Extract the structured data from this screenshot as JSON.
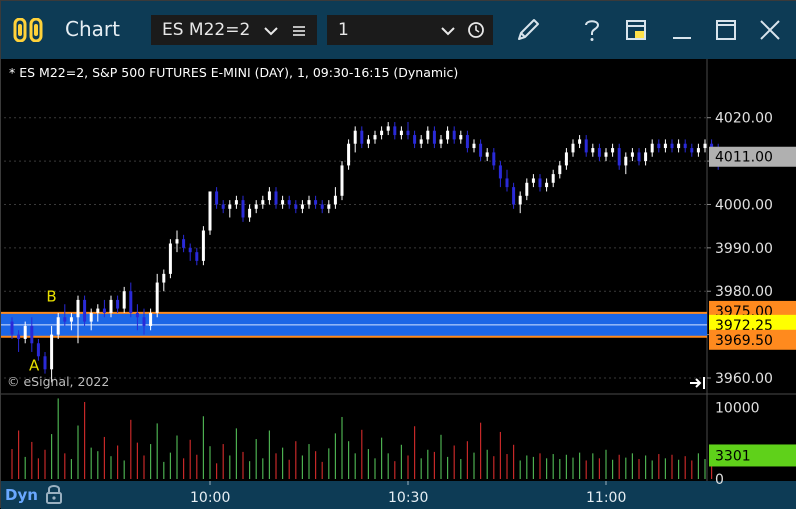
{
  "titlebar": {
    "title": "Chart",
    "symbol": "ES M22=2",
    "interval": "1",
    "icons": [
      "chart-logo-icon",
      "chevron-down-icon",
      "menu-lines-icon",
      "chevron-down-icon",
      "clock-icon",
      "pencil-icon",
      "help-icon",
      "pages-icon",
      "minimize-icon",
      "maximize-icon",
      "close-icon"
    ]
  },
  "chart": {
    "info_line": "* ES M22=2, S&P 500 FUTURES E-MINI (DAY), 1, 09:30-16:15 (Dynamic)",
    "watermark": "© eSignal, 2022",
    "dyn_label": "Dyn",
    "marker_a": "A",
    "marker_b": "B",
    "icons": [
      "jump-to-end-icon",
      "lock-icon"
    ]
  },
  "colors": {
    "titlebar": "#0d3b55",
    "up_candle": "#ffffff",
    "down_candle": "#2a2ad8",
    "zone_fill": "#1d6cf2",
    "zone_edge": "#ff8a1e",
    "volume_up": "#4caf50",
    "volume_down": "#c62828",
    "last_price": "#b0b0b0",
    "last_volume": "#5fd11a"
  },
  "chart_data": {
    "type": "candlestick",
    "price_axis": {
      "ticks": [
        "4020.00",
        "4010.00",
        "4000.00",
        "3990.00",
        "3980.00",
        "3970.00",
        "3960.00"
      ],
      "range": [
        3957,
        4028
      ]
    },
    "price_labels": [
      {
        "text": "4011.00",
        "value": 4011.0,
        "kind": "last-price"
      },
      {
        "text": "3975.00",
        "value": 3975.0,
        "kind": "zone-top"
      },
      {
        "text": "3972.25",
        "value": 3972.25,
        "kind": "zone-mid"
      },
      {
        "text": "3969.50",
        "value": 3969.5,
        "kind": "zone-bottom"
      }
    ],
    "zone": {
      "top": 3975.0,
      "mid": 3972.25,
      "bottom": 3969.5
    },
    "volume_axis": {
      "ticks": [
        "10000",
        "0"
      ],
      "range": [
        0,
        11500
      ]
    },
    "volume_label": {
      "text": "3301",
      "value": 3301
    },
    "time_axis": {
      "ticks": [
        "10:00",
        "10:30",
        "11:00"
      ],
      "tick_bar_index": [
        30,
        60,
        90
      ]
    },
    "ohlc": [
      [
        3973.0,
        3974.0,
        3969.0,
        3970.0
      ],
      [
        3970.0,
        3971.0,
        3966.0,
        3969.0
      ],
      [
        3969.0,
        3973.0,
        3968.0,
        3972.0
      ],
      [
        3972.0,
        3974.0,
        3966.0,
        3968.0
      ],
      [
        3968.0,
        3969.0,
        3964.0,
        3965.0
      ],
      [
        3965.0,
        3966.0,
        3961.0,
        3962.0
      ],
      [
        3962.0,
        3972.0,
        3959.0,
        3970.0
      ],
      [
        3970.0,
        3975.0,
        3969.0,
        3974.0
      ],
      [
        3974.0,
        3977.0,
        3972.0,
        3973.0
      ],
      [
        3973.0,
        3975.0,
        3971.0,
        3974.0
      ],
      [
        3974.0,
        3979.0,
        3968.0,
        3978.0
      ],
      [
        3978.0,
        3979.0,
        3972.0,
        3973.0
      ],
      [
        3973.0,
        3976.0,
        3971.0,
        3975.0
      ],
      [
        3975.0,
        3977.0,
        3973.0,
        3976.0
      ],
      [
        3976.0,
        3978.0,
        3974.0,
        3975.0
      ],
      [
        3975.0,
        3979.0,
        3974.0,
        3978.0
      ],
      [
        3978.0,
        3979.0,
        3975.0,
        3976.0
      ],
      [
        3976.0,
        3981.0,
        3975.0,
        3980.0
      ],
      [
        3980.0,
        3982.0,
        3974.0,
        3975.0
      ],
      [
        3975.0,
        3977.0,
        3971.0,
        3974.0
      ],
      [
        3974.0,
        3976.0,
        3970.0,
        3972.0
      ],
      [
        3972.0,
        3976.0,
        3971.0,
        3975.0
      ],
      [
        3975.0,
        3984.0,
        3974.0,
        3982.0
      ],
      [
        3982.0,
        3985.0,
        3980.0,
        3984.0
      ],
      [
        3984.0,
        3992.0,
        3983.0,
        3991.0
      ],
      [
        3991.0,
        3994.0,
        3989.0,
        3992.0
      ],
      [
        3992.0,
        3993.0,
        3989.0,
        3990.0
      ],
      [
        3990.0,
        3991.0,
        3987.0,
        3989.0
      ],
      [
        3989.0,
        3990.0,
        3986.0,
        3987.0
      ],
      [
        3987.0,
        3995.0,
        3986.0,
        3994.0
      ],
      [
        3994.0,
        4003.0,
        3993.0,
        4003.0
      ],
      [
        4003.0,
        4004.0,
        3999.0,
        4000.0
      ],
      [
        4000.0,
        4001.0,
        3998.0,
        3999.0
      ],
      [
        3999.0,
        4001.0,
        3997.0,
        4000.0
      ],
      [
        4000.0,
        4002.0,
        3999.0,
        4001.0
      ],
      [
        4001.0,
        4002.0,
        3996.0,
        3997.0
      ],
      [
        3997.0,
        4000.0,
        3996.0,
        3999.0
      ],
      [
        3999.0,
        4001.0,
        3998.0,
        4000.0
      ],
      [
        4000.0,
        4002.0,
        3999.0,
        4001.0
      ],
      [
        4001.0,
        4004.0,
        4000.0,
        4003.0
      ],
      [
        4003.0,
        4004.0,
        3999.0,
        4000.0
      ],
      [
        4000.0,
        4002.0,
        3999.0,
        4001.0
      ],
      [
        4001.0,
        4002.0,
        3999.0,
        4000.0
      ],
      [
        4000.0,
        4001.0,
        3998.0,
        3999.0
      ],
      [
        3999.0,
        4001.0,
        3998.0,
        4000.0
      ],
      [
        4000.0,
        4002.0,
        3999.0,
        4001.0
      ],
      [
        4001.0,
        4002.0,
        3999.0,
        4000.0
      ],
      [
        4000.0,
        4001.0,
        3998.0,
        3999.0
      ],
      [
        3999.0,
        4001.0,
        3998.0,
        4000.0
      ],
      [
        4000.0,
        4004.0,
        3999.0,
        4002.0
      ],
      [
        4002.0,
        4010.0,
        4001.0,
        4009.0
      ],
      [
        4009.0,
        4015.0,
        4008.0,
        4014.0
      ],
      [
        4014.0,
        4018.0,
        4012.0,
        4017.0
      ],
      [
        4017.0,
        4018.0,
        4013.0,
        4014.0
      ],
      [
        4014.0,
        4016.0,
        4013.0,
        4015.0
      ],
      [
        4015.0,
        4017.0,
        4014.0,
        4016.0
      ],
      [
        4016.0,
        4018.0,
        4015.0,
        4017.0
      ],
      [
        4017.0,
        4019.0,
        4016.0,
        4018.0
      ],
      [
        4018.0,
        4019.0,
        4015.0,
        4016.0
      ],
      [
        4016.0,
        4018.0,
        4015.0,
        4017.0
      ],
      [
        4017.0,
        4019.0,
        4015.0,
        4016.0
      ],
      [
        4016.0,
        4017.0,
        4013.0,
        4014.0
      ],
      [
        4014.0,
        4016.0,
        4013.0,
        4015.0
      ],
      [
        4015.0,
        4018.0,
        4014.0,
        4017.0
      ],
      [
        4017.0,
        4018.0,
        4013.0,
        4014.0
      ],
      [
        4014.0,
        4016.0,
        4013.0,
        4015.0
      ],
      [
        4015.0,
        4018.0,
        4014.0,
        4017.0
      ],
      [
        4017.0,
        4018.0,
        4014.0,
        4015.0
      ],
      [
        4015.0,
        4017.0,
        4014.0,
        4016.0
      ],
      [
        4016.0,
        4017.0,
        4012.0,
        4013.0
      ],
      [
        4013.0,
        4015.0,
        4012.0,
        4014.0
      ],
      [
        4014.0,
        4015.0,
        4010.0,
        4011.0
      ],
      [
        4011.0,
        4013.0,
        4010.0,
        4012.0
      ],
      [
        4012.0,
        4013.0,
        4008.0,
        4009.0
      ],
      [
        4009.0,
        4010.0,
        4004.0,
        4006.0
      ],
      [
        4006.0,
        4008.0,
        4003.0,
        4004.0
      ],
      [
        4004.0,
        4005.0,
        3999.0,
        4000.0
      ],
      [
        4000.0,
        4003.0,
        3998.0,
        4002.0
      ],
      [
        4002.0,
        4006.0,
        4001.0,
        4005.0
      ],
      [
        4005.0,
        4007.0,
        4004.0,
        4006.0
      ],
      [
        4006.0,
        4007.0,
        4003.0,
        4004.0
      ],
      [
        4004.0,
        4006.0,
        4003.0,
        4005.0
      ],
      [
        4005.0,
        4008.0,
        4004.0,
        4007.0
      ],
      [
        4007.0,
        4010.0,
        4006.0,
        4009.0
      ],
      [
        4009.0,
        4013.0,
        4008.0,
        4012.0
      ],
      [
        4012.0,
        4015.0,
        4011.0,
        4014.0
      ],
      [
        4014.0,
        4016.0,
        4013.0,
        4015.0
      ],
      [
        4015.0,
        4016.0,
        4011.0,
        4012.0
      ],
      [
        4012.0,
        4014.0,
        4011.0,
        4013.0
      ],
      [
        4013.0,
        4014.0,
        4010.0,
        4011.0
      ],
      [
        4011.0,
        4013.0,
        4010.0,
        4012.0
      ],
      [
        4012.0,
        4014.0,
        4011.0,
        4013.0
      ],
      [
        4013.0,
        4014.0,
        4008.0,
        4009.0
      ],
      [
        4009.0,
        4012.0,
        4007.0,
        4011.0
      ],
      [
        4011.0,
        4013.0,
        4010.0,
        4012.0
      ],
      [
        4012.0,
        4013.0,
        4009.0,
        4010.0
      ],
      [
        4010.0,
        4013.0,
        4009.0,
        4012.0
      ],
      [
        4012.0,
        4015.0,
        4011.0,
        4014.0
      ],
      [
        4014.0,
        4015.0,
        4012.0,
        4013.0
      ],
      [
        4013.0,
        4015.0,
        4012.0,
        4014.0
      ],
      [
        4014.0,
        4015.0,
        4012.0,
        4013.0
      ],
      [
        4013.0,
        4015.0,
        4012.0,
        4014.0
      ],
      [
        4014.0,
        4015.0,
        4012.0,
        4013.0
      ],
      [
        4013.0,
        4014.0,
        4011.0,
        4012.0
      ],
      [
        4012.0,
        4014.0,
        4011.0,
        4013.0
      ],
      [
        4013.0,
        4015.0,
        4012.0,
        4014.0
      ],
      [
        4014.0,
        4015.0,
        4011.0,
        4012.0
      ],
      [
        4012.0,
        4014.0,
        4008.0,
        4011.0
      ]
    ],
    "volume": [
      4200,
      6800,
      3100,
      5200,
      2900,
      4100,
      6300,
      11300,
      3600,
      2800,
      7500,
      10800,
      4400,
      3900,
      5900,
      3200,
      4700,
      2600,
      8300,
      5100,
      3300,
      4900,
      7800,
      2400,
      3700,
      6100,
      2900,
      5500,
      3400,
      8800,
      4600,
      2200,
      4900,
      3300,
      7100,
      3800,
      2500,
      5600,
      2900,
      6800,
      3600,
      4400,
      2700,
      5300,
      3300,
      4900,
      3900,
      2400,
      4300,
      6400,
      8700,
      5300,
      3600,
      6900,
      4200,
      2900,
      5800,
      3600,
      2500,
      4800,
      3300,
      7400,
      2900,
      4100,
      3800,
      6200,
      3100,
      4700,
      2800,
      5300,
      3700,
      7900,
      4100,
      3200,
      6600,
      3500,
      4800,
      2600,
      3300,
      3100,
      3600,
      2900,
      3500,
      2800,
      3400,
      3000,
      3700,
      2600,
      3600,
      2900,
      4100,
      2700,
      3400,
      3000,
      3600,
      2800,
      3300,
      2600,
      3500,
      2900,
      3400,
      2700,
      3200,
      2600,
      3600,
      2800,
      3301
    ]
  }
}
